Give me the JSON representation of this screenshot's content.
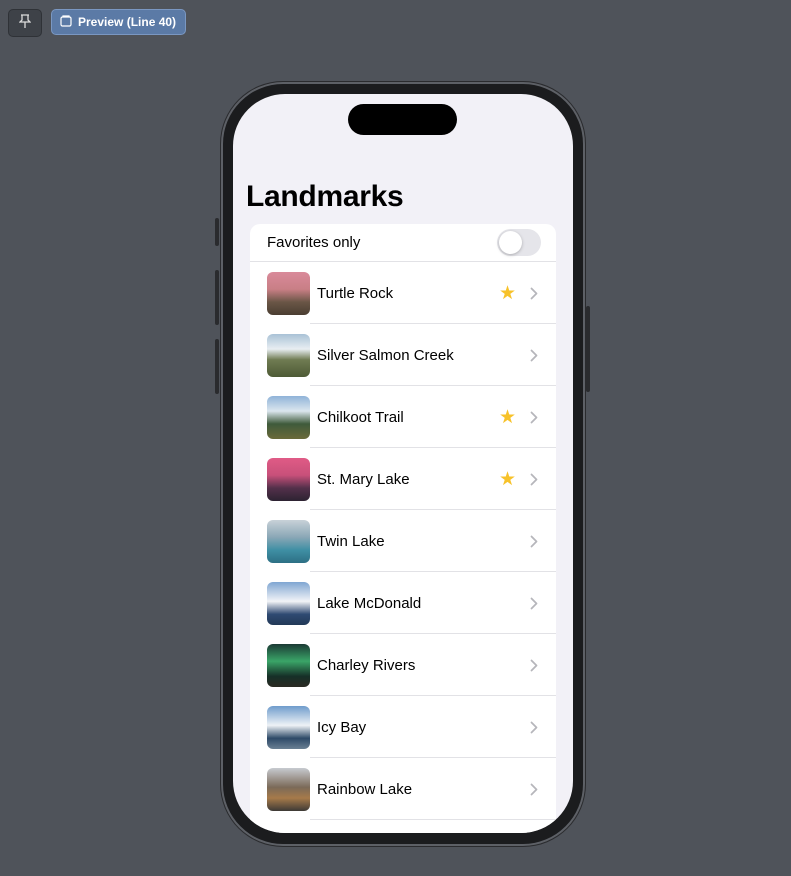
{
  "toolbar": {
    "pin_icon": "pin-icon",
    "preview_icon": "preview-icon",
    "preview_label": "Preview (Line 40)"
  },
  "screen": {
    "title": "Landmarks",
    "favorites_label": "Favorites only",
    "favorites_on": false,
    "landmarks": [
      {
        "name": "Turtle Rock",
        "favorite": true
      },
      {
        "name": "Silver Salmon Creek",
        "favorite": false
      },
      {
        "name": "Chilkoot Trail",
        "favorite": true
      },
      {
        "name": "St. Mary Lake",
        "favorite": true
      },
      {
        "name": "Twin Lake",
        "favorite": false
      },
      {
        "name": "Lake McDonald",
        "favorite": false
      },
      {
        "name": "Charley Rivers",
        "favorite": false
      },
      {
        "name": "Icy Bay",
        "favorite": false
      },
      {
        "name": "Rainbow Lake",
        "favorite": false
      }
    ]
  },
  "colors": {
    "background": "#4f535a",
    "star": "#f7c22a",
    "accent_button": "#5b7aa6"
  }
}
